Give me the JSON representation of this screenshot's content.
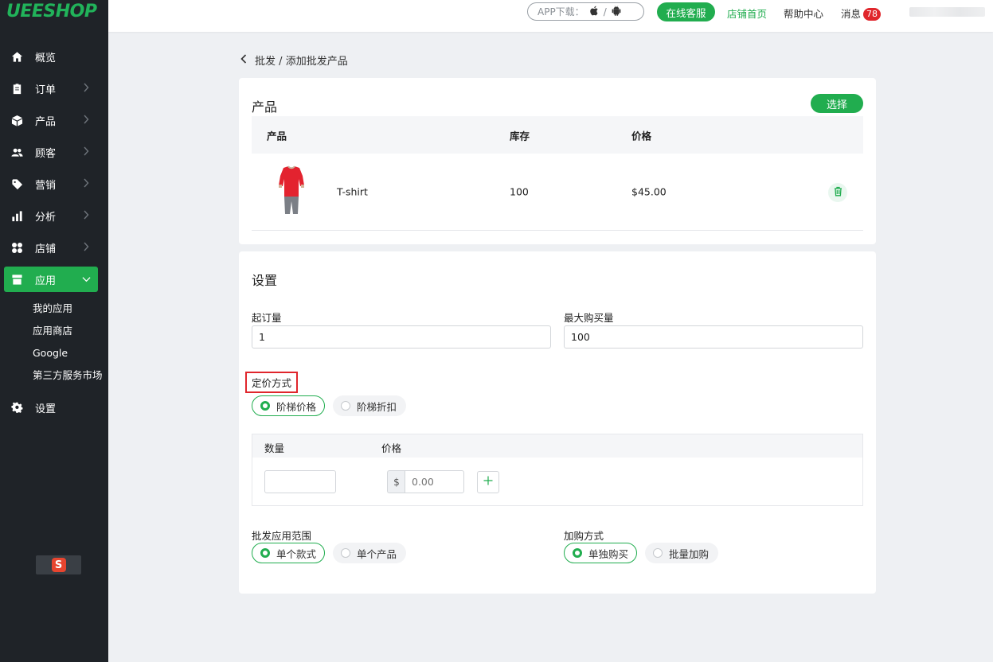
{
  "app": {
    "logo": "UEESHOP"
  },
  "topbar": {
    "app_download": "APP下载：",
    "online_service": "在线客服",
    "store_home": "店铺首页",
    "help_center": "帮助中心",
    "messages": "消息",
    "messages_count": "78"
  },
  "sidebar": {
    "items": [
      {
        "label": "概览",
        "icon": "home-icon"
      },
      {
        "label": "订单",
        "icon": "clipboard-icon"
      },
      {
        "label": "产品",
        "icon": "box-icon"
      },
      {
        "label": "顾客",
        "icon": "users-icon"
      },
      {
        "label": "营销",
        "icon": "tag-icon"
      },
      {
        "label": "分析",
        "icon": "bar-chart-icon"
      },
      {
        "label": "店铺",
        "icon": "grid-icon"
      },
      {
        "label": "应用",
        "icon": "store-icon"
      },
      {
        "label": "设置",
        "icon": "gear-icon"
      }
    ],
    "sub_items": [
      "我的应用",
      "应用商店",
      "Google",
      "第三方服务市场"
    ]
  },
  "breadcrumb": {
    "parent": "批发",
    "separator": "/",
    "current": "添加批发产品"
  },
  "product_card": {
    "title": "产品",
    "select_button": "选择",
    "columns": [
      "产品",
      "库存",
      "价格"
    ],
    "rows": [
      {
        "name": "T-shirt",
        "stock": "100",
        "price": "$45.00"
      }
    ]
  },
  "settings_card": {
    "title": "设置",
    "min_order_label": "起订量",
    "min_order_value": "1",
    "max_purchase_label": "最大购买量",
    "max_purchase_value": "100",
    "pricing_method_label": "定价方式",
    "pricing_options": [
      "阶梯价格",
      "阶梯折扣"
    ],
    "pricing_selected": "阶梯价格",
    "tier_columns": [
      "数量",
      "价格"
    ],
    "currency_symbol": "$",
    "price_placeholder": "0.00",
    "scope_label": "批发应用范围",
    "scope_options": [
      "单个款式",
      "单个产品"
    ],
    "purchase_label": "加购方式",
    "purchase_options": [
      "单独购买",
      "批量加购"
    ]
  },
  "colors": {
    "brand": "#21ad4f",
    "sidebar": "#1f2328",
    "badge": "#e0262c",
    "highlight_border": "#e0262c"
  }
}
